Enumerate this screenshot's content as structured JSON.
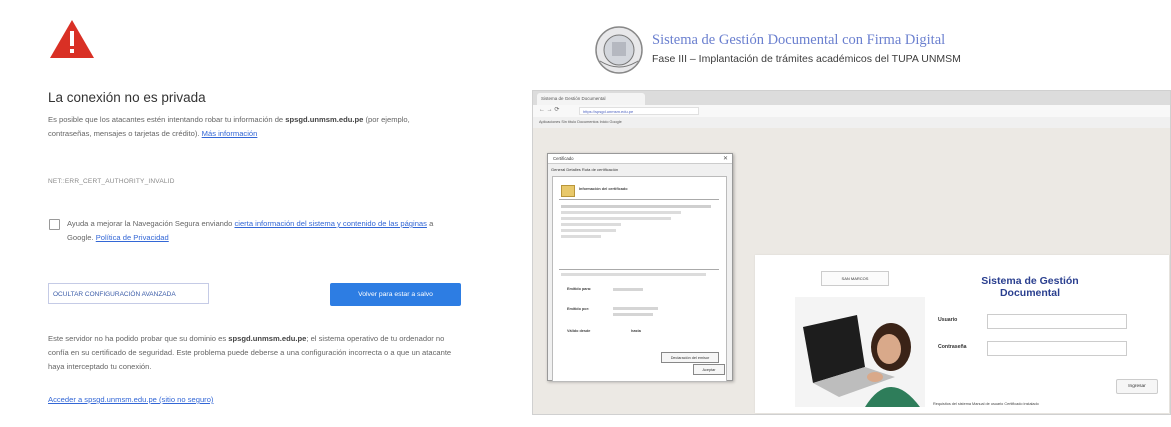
{
  "error_page": {
    "title": "La conexión no es privada",
    "intro_text": "Es posible que los atacantes estén intentando robar tu información de",
    "host": "spsgd.unmsm.edu.pe",
    "intro_text2": "(por ejemplo, contraseñas, mensajes o tarjetas de crédito).",
    "more_info": "Más información",
    "error_code": "NET::ERR_CERT_AUTHORITY_INVALID",
    "checkbox_text": "Ayuda a mejorar la Navegación Segura enviando",
    "checkbox_link": "cierta información del sistema y contenido de las páginas",
    "checkbox_text2": "a Google.",
    "privacy_link": "Política de Privacidad",
    "advanced_button": "OCULTAR CONFIGURACIÓN AVANZADA",
    "back_button": "Volver para estar a salvo",
    "explain_text1": "Este servidor no ha podido probar que su dominio es",
    "explain_host": "spsgd.unmsm.edu.pe",
    "explain_text2": "; el sistema operativo de tu ordenador no confía en su certificado de seguridad. Este problema puede deberse a una configuración incorrecta o a que un atacante haya interceptado tu conexión.",
    "proceed_link": "Acceder a spsgd.unmsm.edu.pe (sitio no seguro)"
  },
  "header": {
    "title": "Sistema de Gestión Documental con Firma Digital",
    "subtitle": "Fase III – Implantación de trámites académicos del TUPA UNMSM"
  },
  "browser": {
    "tab": "Sistema de Gestión Documental",
    "url": "https://spsgd.unmsm.edu.pe",
    "bookmarks": "Aplicaciones   Sin título   Documentos   Inicio   Google"
  },
  "certificate": {
    "window_title": "Certificado",
    "tabs": "General   Detalles   Ruta de certificación",
    "heading": "Información del certificado",
    "issued_to_label": "Emitido para:",
    "issued_by_label": "Emitido por:",
    "valid_label": "Válido desde",
    "to_label": "hasta",
    "declaration_button": "Declaración del emisor",
    "accept_button": "Aceptar"
  },
  "login": {
    "logo_text": "SAN MARCOS",
    "title": "Sistema de Gestión Documental",
    "user_label": "Usuario",
    "password_label": "Contraseña",
    "submit": "Ingresar",
    "footer": "Requisitos del sistema   Manual de usuario   Certificado instalado"
  },
  "colors": {
    "warning": "#d93025",
    "link": "#3367d6",
    "primary_button": "#2d7de3",
    "login_title": "#2a3f8f"
  }
}
